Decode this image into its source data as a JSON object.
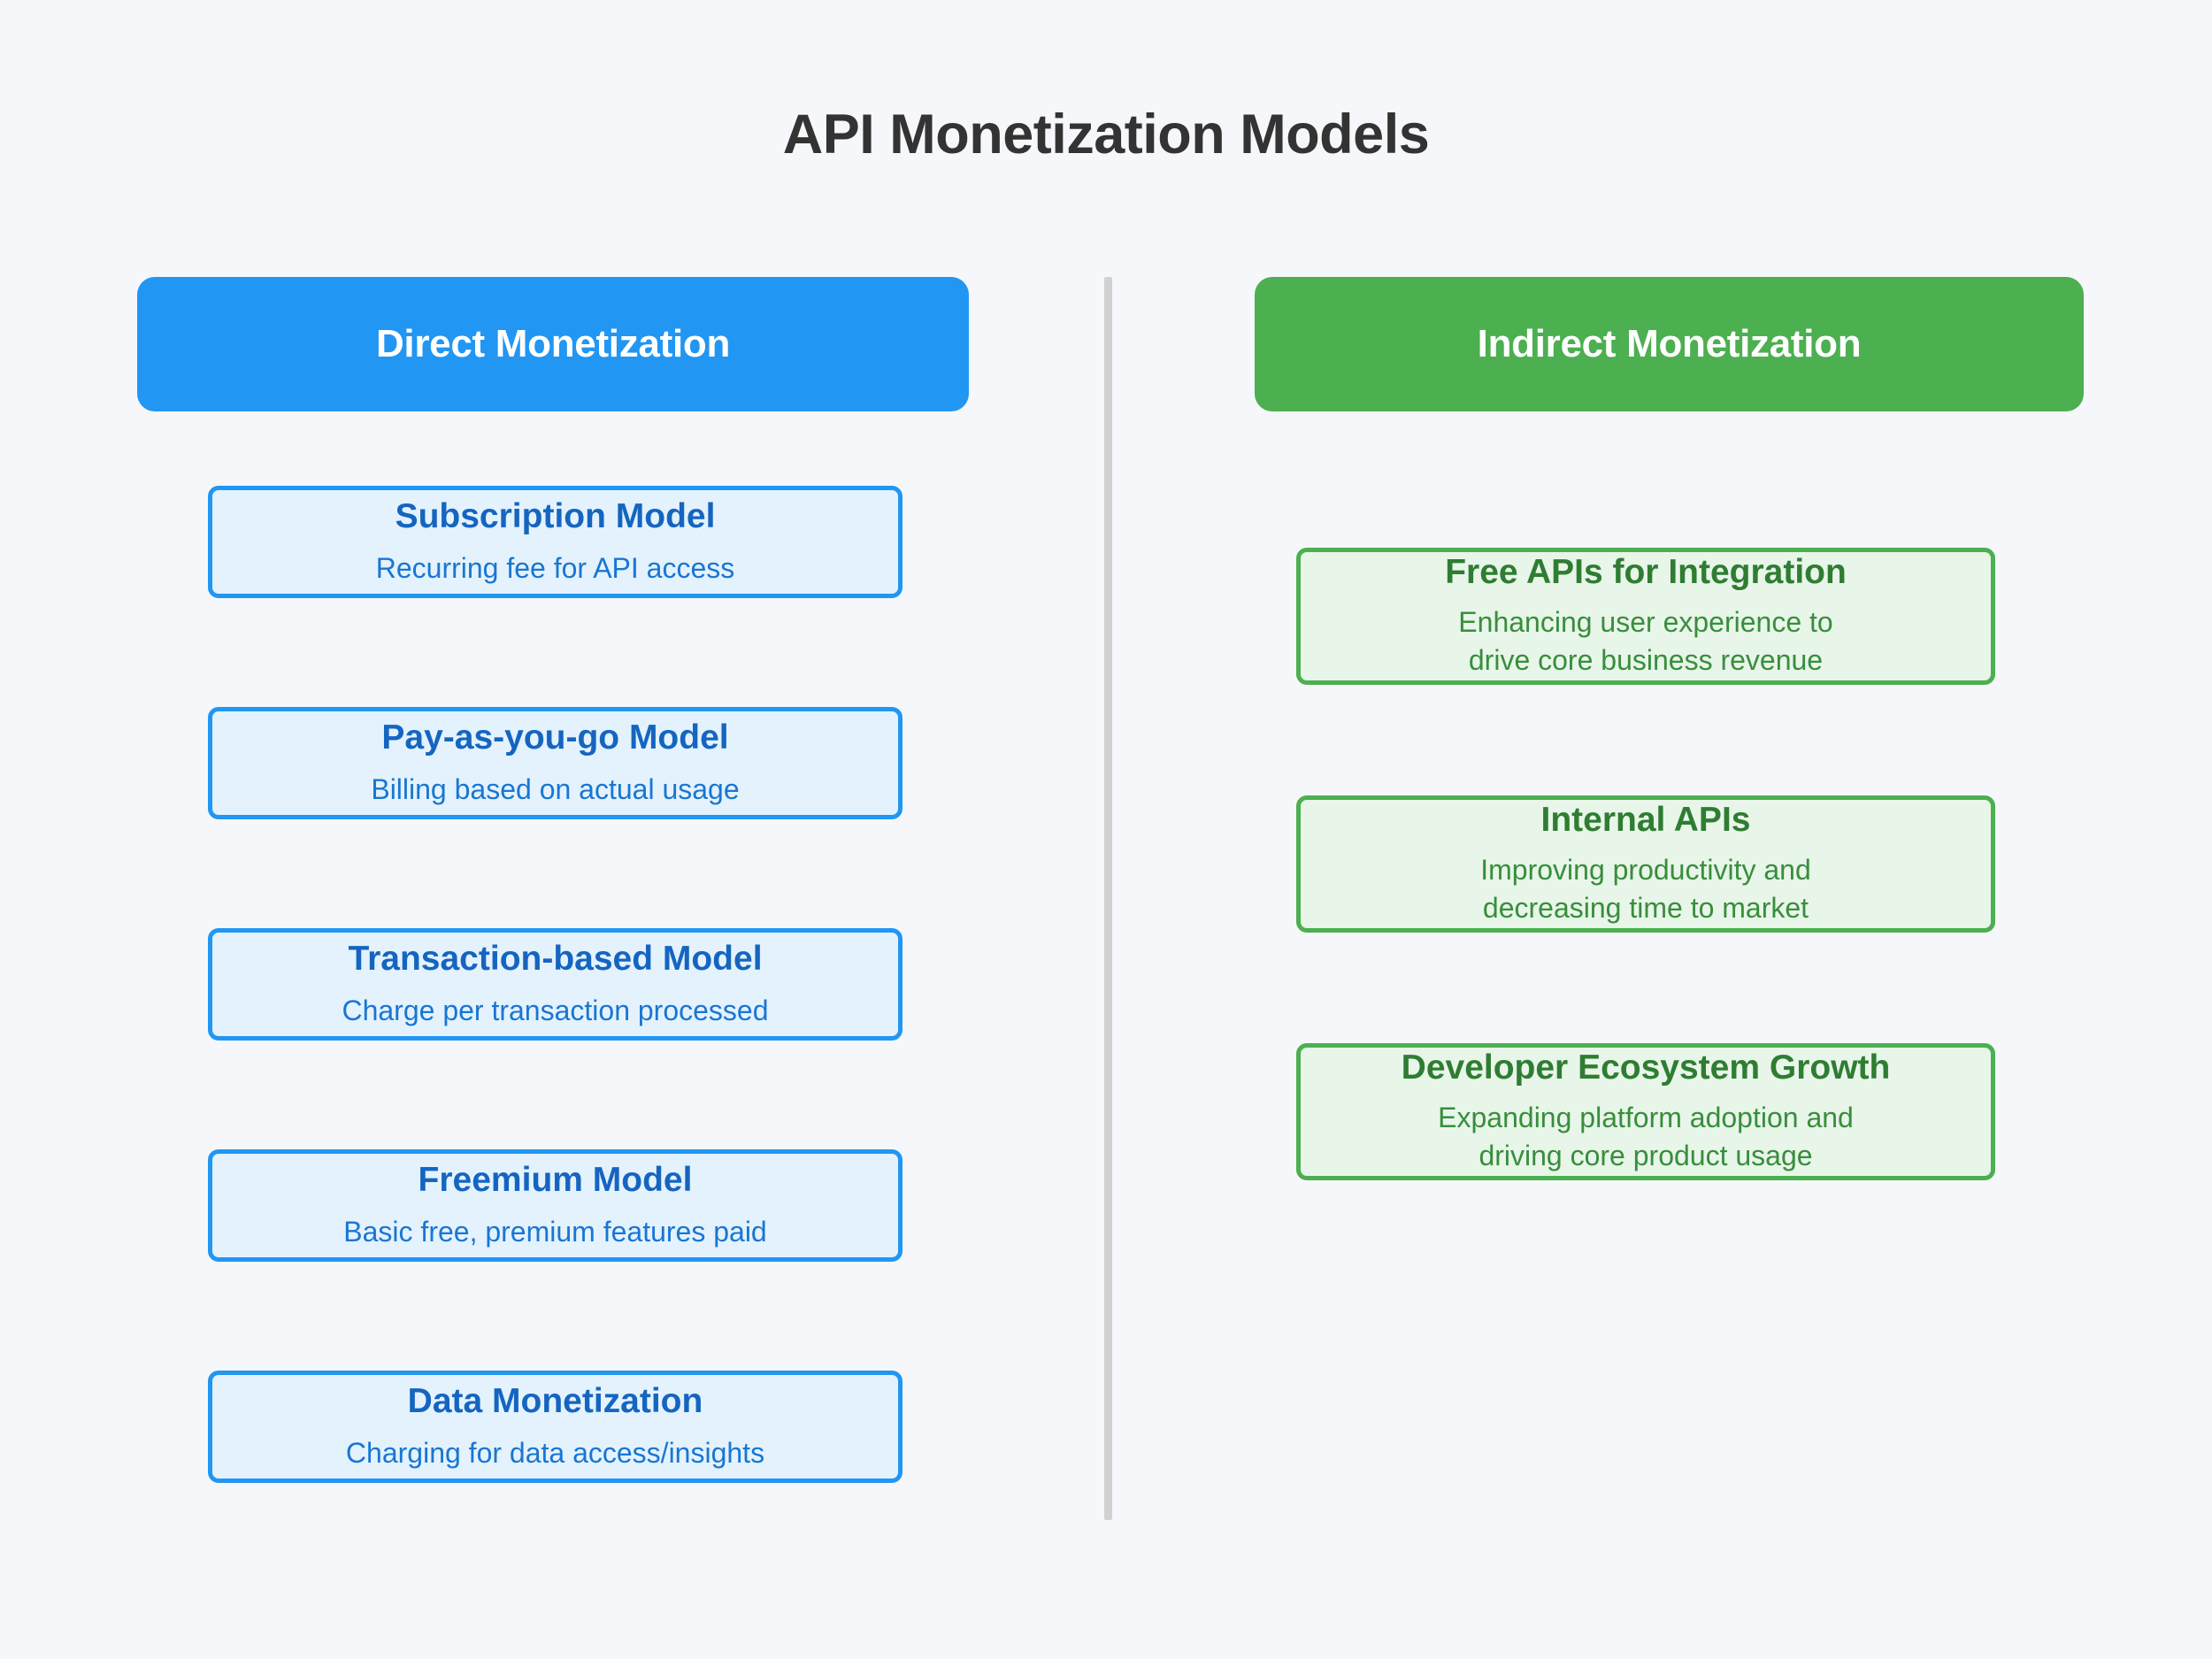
{
  "title": "API Monetization Models",
  "colors": {
    "background": "#f5f7fa",
    "title_text": "#333333",
    "direct_accent": "#2196f3",
    "direct_card_bg": "#e3f2fd",
    "direct_title_text": "#1565c0",
    "direct_desc_text": "#1976d2",
    "indirect_accent": "#4caf50",
    "indirect_card_bg": "#e8f5e9",
    "indirect_title_text": "#2e7d32",
    "indirect_desc_text": "#388e3c",
    "divider": "#d1d1d1"
  },
  "columns": {
    "direct": {
      "header": "Direct Monetization",
      "cards": [
        {
          "title": "Subscription Model",
          "desc_lines": [
            "Recurring fee for API access"
          ]
        },
        {
          "title": "Pay-as-you-go Model",
          "desc_lines": [
            "Billing based on actual usage"
          ]
        },
        {
          "title": "Transaction-based Model",
          "desc_lines": [
            "Charge per transaction processed"
          ]
        },
        {
          "title": "Freemium Model",
          "desc_lines": [
            "Basic free, premium features paid"
          ]
        },
        {
          "title": "Data Monetization",
          "desc_lines": [
            "Charging for data access/insights"
          ]
        }
      ]
    },
    "indirect": {
      "header": "Indirect Monetization",
      "cards": [
        {
          "title": "Free APIs for Integration",
          "desc_lines": [
            "Enhancing user experience to",
            "drive core business revenue"
          ]
        },
        {
          "title": "Internal APIs",
          "desc_lines": [
            "Improving productivity and",
            "decreasing time to market"
          ]
        },
        {
          "title": "Developer Ecosystem Growth",
          "desc_lines": [
            "Expanding platform adoption and",
            "driving core product usage"
          ]
        }
      ]
    }
  }
}
